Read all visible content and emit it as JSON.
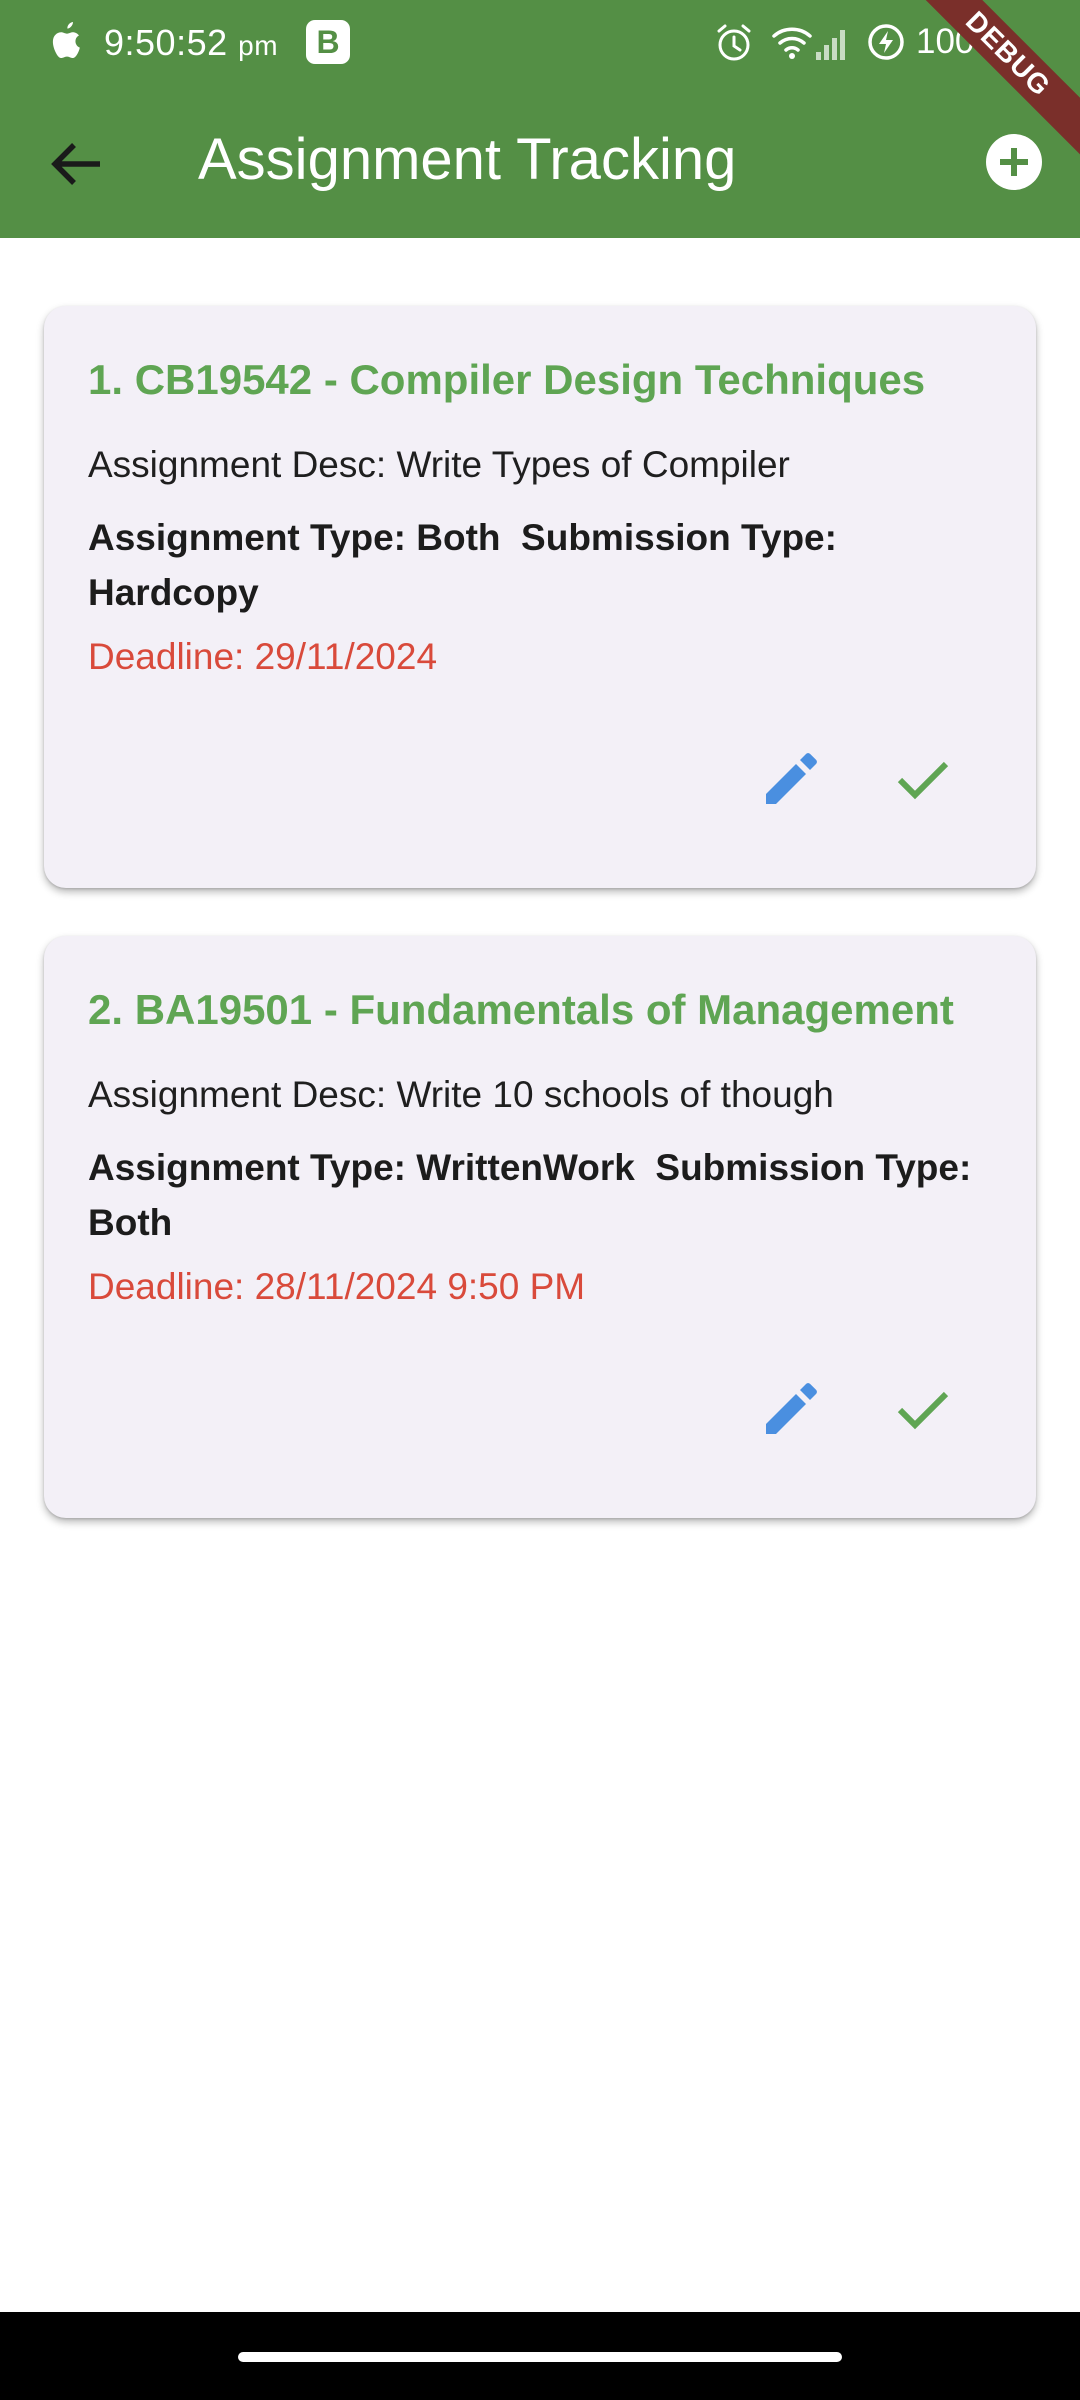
{
  "status_bar": {
    "time": "9:50:52",
    "ampm": "pm",
    "badge": "B",
    "battery": "100"
  },
  "debug_banner": "DEBUG",
  "app_bar": {
    "title": "Assignment Tracking",
    "back_icon": "arrow-back-icon",
    "add_icon": "add-circle-icon"
  },
  "assignments": [
    {
      "title": "1. CB19542 - Compiler Design Techniques",
      "desc": "Assignment Desc: Write Types of Compiler",
      "type_line_1": "Assignment Type: Both  Submission Type:",
      "type_line_2": "Hardcopy",
      "deadline": "Deadline: 29/11/2024"
    },
    {
      "title": "2. BA19501 - Fundamentals of Management",
      "desc": "Assignment Desc: Write 10 schools of though",
      "type_line_1": "Assignment Type: WrittenWork  Submission Type:",
      "type_line_2": "Both",
      "deadline": "Deadline: 28/11/2024 9:50 PM"
    }
  ],
  "colors": {
    "app_bar": "#548f45",
    "title_green": "#5fa553",
    "deadline_red": "#d94a3b",
    "edit_blue": "#4a8fe0",
    "check_green": "#5fa553",
    "card_bg": "#f3f0f7"
  }
}
